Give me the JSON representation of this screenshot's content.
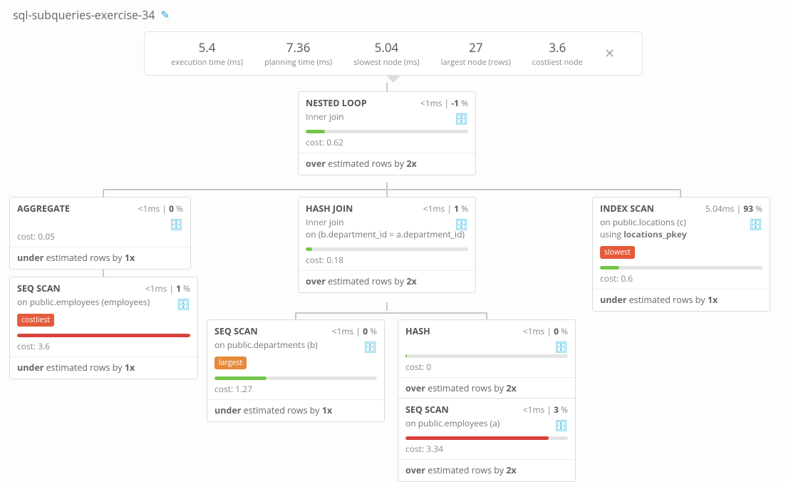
{
  "page_title": "sql-subqueries-exercise-34",
  "stats": {
    "exec_value": "5.4",
    "exec_label": "execution time (ms)",
    "plan_value": "7.36",
    "plan_label": "planning time (ms)",
    "slow_value": "5.04",
    "slow_label": "slowest node (ms)",
    "large_value": "27",
    "large_label": "largest node (rows)",
    "costly_value": "3.6",
    "costly_label": "costliest node"
  },
  "labels": {
    "cost_prefix": "cost: ",
    "inner_join": "Inner",
    "join_suffix": " join",
    "on_prefix": "on ",
    "using_prefix": "using ",
    "over_word": "over",
    "under_word": "under",
    "est_mid": " estimated rows by "
  },
  "badges": {
    "costliest": "costliest",
    "largest": "largest",
    "slowest": "slowest"
  },
  "nodes": {
    "nested": {
      "name": "NESTED LOOP",
      "time": "<1ms",
      "pct": "-1",
      "cost": "0.62",
      "est_dir": "over",
      "est_x": "2",
      "bar_pct": 12,
      "bar_color": "green"
    },
    "agg": {
      "name": "AGGREGATE",
      "time": "<1ms",
      "pct": "0",
      "cost": "0.05",
      "est_dir": "under",
      "est_x": "1"
    },
    "hashjoin": {
      "name": "HASH JOIN",
      "time": "<1ms",
      "pct": "1",
      "cond": "(b.department_id = a.department_id)",
      "cost": "0.18",
      "est_dir": "over",
      "est_x": "2",
      "bar_pct": 4,
      "bar_color": "green"
    },
    "index": {
      "name": "INDEX SCAN",
      "time": "5.04ms",
      "pct": "93",
      "on": "public.locations (c)",
      "using": "locations_pkey",
      "cost": "0.6",
      "est_dir": "under",
      "est_x": "1",
      "bar_pct": 12,
      "bar_color": "green"
    },
    "seq_emp": {
      "name": "SEQ SCAN",
      "time": "<1ms",
      "pct": "1",
      "on": "public.employees (employees)",
      "cost": "3.6",
      "est_dir": "under",
      "est_x": "1",
      "bar_pct": 100,
      "bar_color": "red"
    },
    "seq_dep": {
      "name": "SEQ SCAN",
      "time": "<1ms",
      "pct": "0",
      "on": "public.departments (b)",
      "cost": "1.27",
      "est_dir": "under",
      "est_x": "1",
      "bar_pct": 32,
      "bar_color": "green"
    },
    "hash": {
      "name": "HASH",
      "time": "<1ms",
      "pct": "0",
      "cost": "0",
      "est_dir": "over",
      "est_x": "2",
      "bar_pct": 1,
      "bar_color": "green"
    },
    "seq_a": {
      "name": "SEQ SCAN",
      "time": "<1ms",
      "pct": "3",
      "on": "public.employees (a)",
      "cost": "3.34",
      "est_dir": "over",
      "est_x": "2",
      "bar_pct": 88,
      "bar_color": "red"
    }
  }
}
